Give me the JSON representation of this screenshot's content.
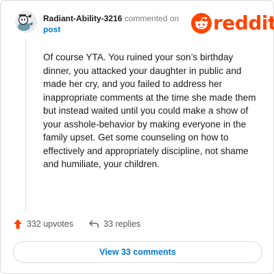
{
  "header": {
    "username": "Radiant-Ability-3216",
    "action_text": "commented on",
    "link_text": "post"
  },
  "logo": {
    "wordmark": "reddit",
    "icon": "reddit-snoo-icon",
    "color": "#ff4500"
  },
  "comment": {
    "body": "Of course YTA. You ruined your son’s birthday dinner, you attacked your daughter in public and made her cry, and you failed to address her inappropriate comments at the time she made them but instead waited until you could make a show of your asshole-behavior by making everyone in the family upset. Get some counseling on how to effectively and appropriately discipline, not shame and humiliate, your children."
  },
  "actions": {
    "upvotes_label": "332 upvotes",
    "upvote_icon": "upvote-arrow-icon",
    "replies_label": "33 replies",
    "reply_icon": "reply-arrow-icon"
  },
  "footer": {
    "view_comments_label": "View 33 comments"
  },
  "colors": {
    "accent": "#ff4500",
    "link": "#0079d3",
    "text": "#1a1a1b",
    "muted": "#7c7c7c"
  }
}
